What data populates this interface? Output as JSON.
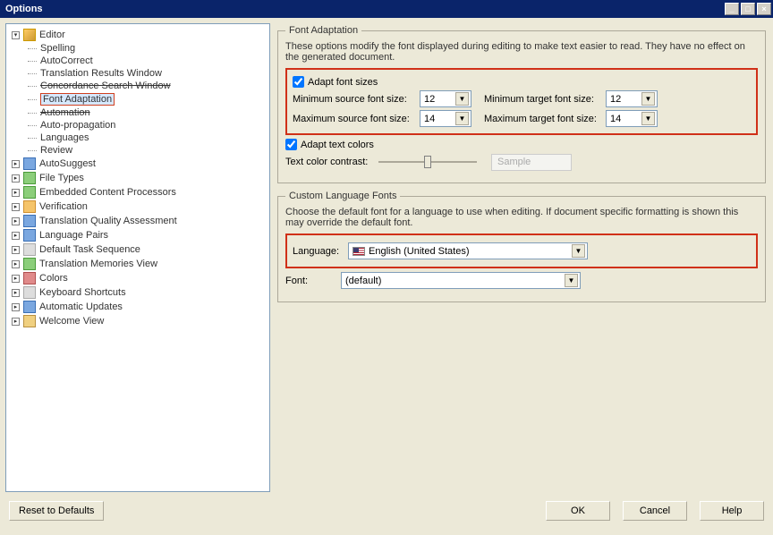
{
  "title": "Options",
  "tree": {
    "editor": "Editor",
    "spelling": "Spelling",
    "autocorrect": "AutoCorrect",
    "trw": "Translation Results Window",
    "csw": "Concordance Search Window",
    "fontadapt": "Font Adaptation",
    "automation": "Automation",
    "autoprop": "Auto-propagation",
    "languages": "Languages",
    "review": "Review",
    "autosuggest": "AutoSuggest",
    "filetypes": "File Types",
    "ecp": "Embedded Content Processors",
    "verification": "Verification",
    "tqa": "Translation Quality Assessment",
    "langpairs": "Language Pairs",
    "dts": "Default Task Sequence",
    "tmv": "Translation Memories View",
    "colors": "Colors",
    "keyshort": "Keyboard Shortcuts",
    "autoupd": "Automatic Updates",
    "welcome": "Welcome View"
  },
  "fa": {
    "legend": "Font Adaptation",
    "desc": "These options modify the font displayed during editing to make text easier to read. They have no effect on the generated document.",
    "adaptSizes": "Adapt font sizes",
    "minSrcLbl": "Minimum source font size:",
    "minSrcVal": "12",
    "minTgtLbl": "Minimum target font size:",
    "minTgtVal": "12",
    "maxSrcLbl": "Maximum source font size:",
    "maxSrcVal": "14",
    "maxTgtLbl": "Maximum target font size:",
    "maxTgtVal": "14",
    "adaptColors": "Adapt text colors",
    "contrastLbl": "Text color contrast:",
    "sample": "Sample"
  },
  "clf": {
    "legend": "Custom Language Fonts",
    "desc": "Choose the default font for a language to use when editing. If document specific formatting is shown this may override the default font.",
    "langLbl": "Language:",
    "langVal": "English (United States)",
    "fontLbl": "Font:",
    "fontVal": "(default)"
  },
  "buttons": {
    "reset": "Reset to Defaults",
    "ok": "OK",
    "cancel": "Cancel",
    "help": "Help"
  }
}
